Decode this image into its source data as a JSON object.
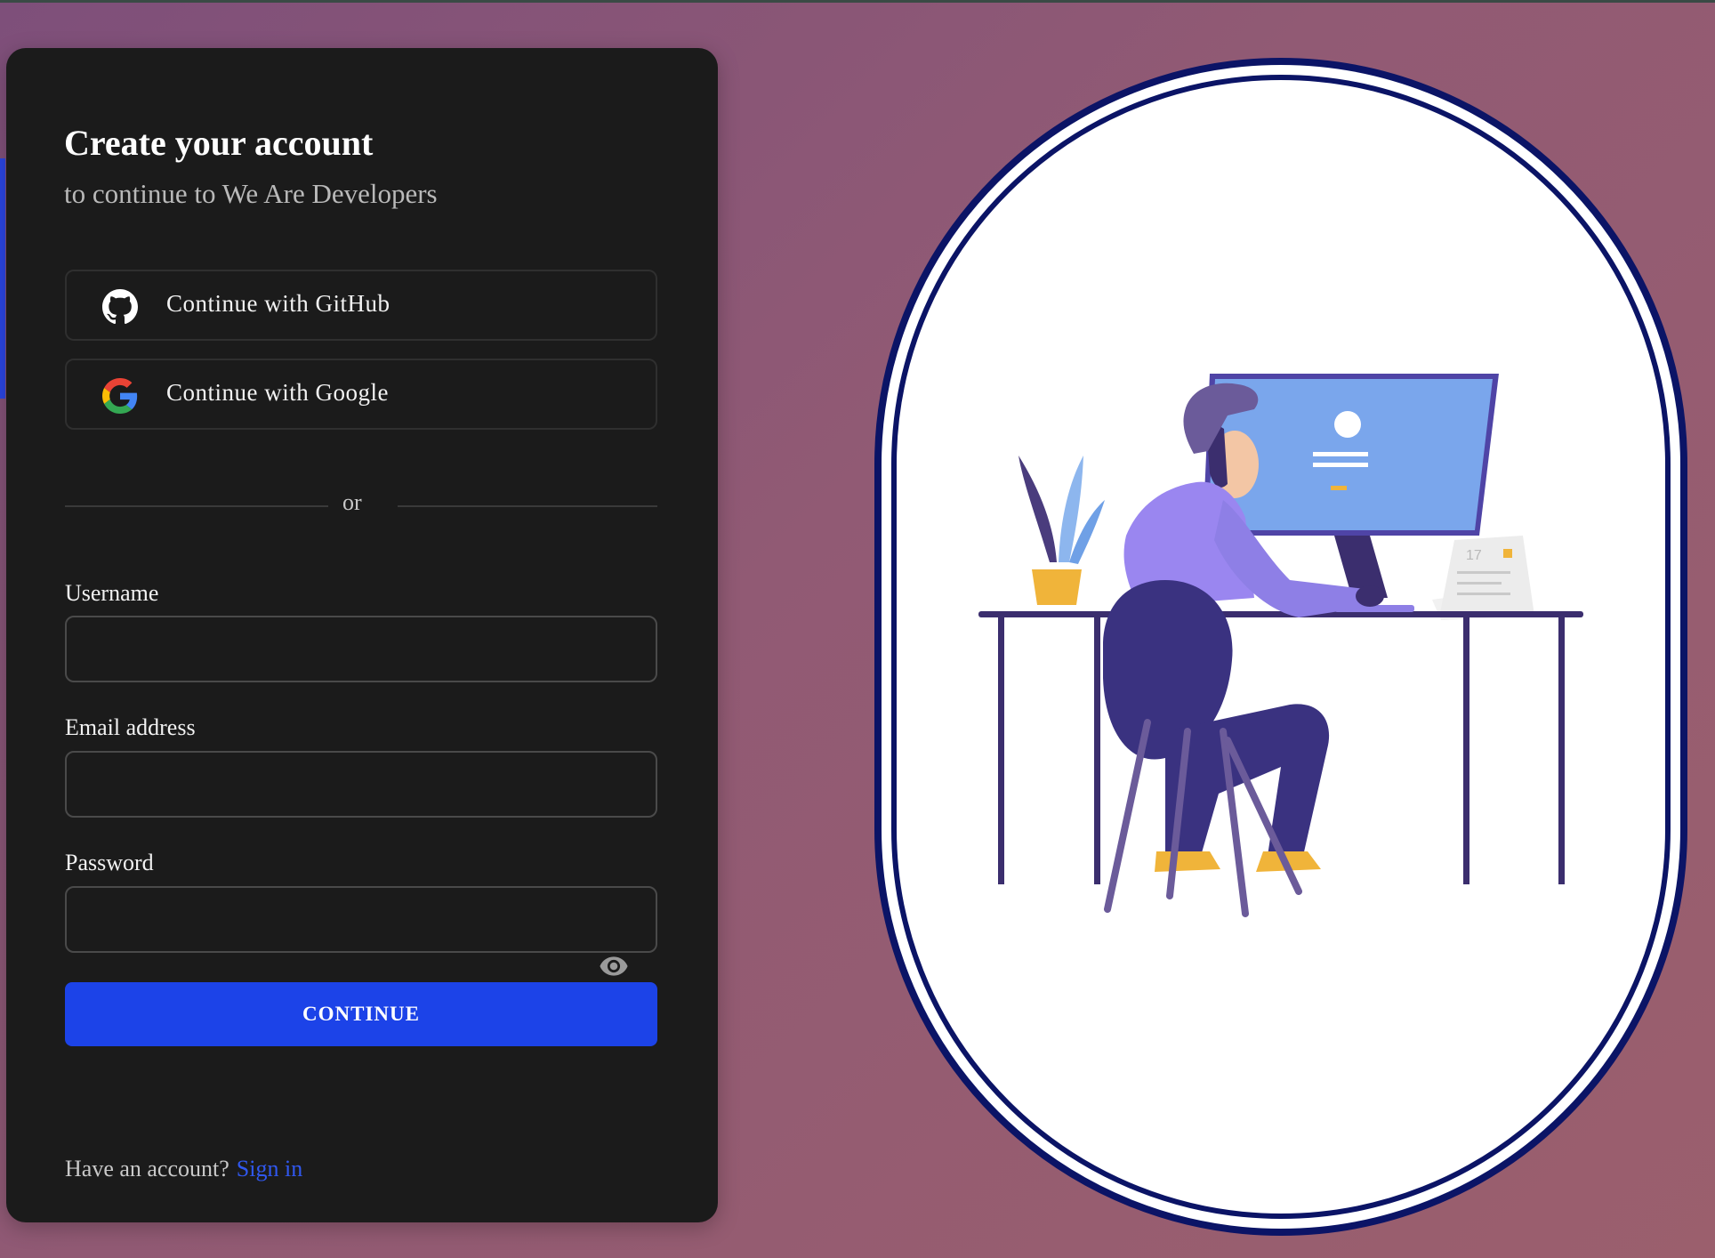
{
  "form": {
    "title": "Create your account",
    "subtitle": "to continue to We Are Developers",
    "github_label": "Continue with GitHub",
    "google_label": "Continue with Google",
    "divider": "or",
    "username_label": "Username",
    "username_value": "",
    "email_label": "Email address",
    "email_value": "",
    "password_label": "Password",
    "password_value": "",
    "continue_label": "CONTINUE",
    "footer_prompt": "Have an account?",
    "signin_link": "Sign in"
  },
  "icons": {
    "github": "github-icon",
    "google": "google-icon",
    "password_toggle": "eye-icon"
  },
  "illustration": {
    "subject": "developer-at-desk-illustration",
    "calendar_day": "17"
  },
  "colors": {
    "background": "#915a74",
    "card": "#1b1b1b",
    "accent": "#1c43e8",
    "link": "#3058f0",
    "frame_border": "#0b1466"
  }
}
